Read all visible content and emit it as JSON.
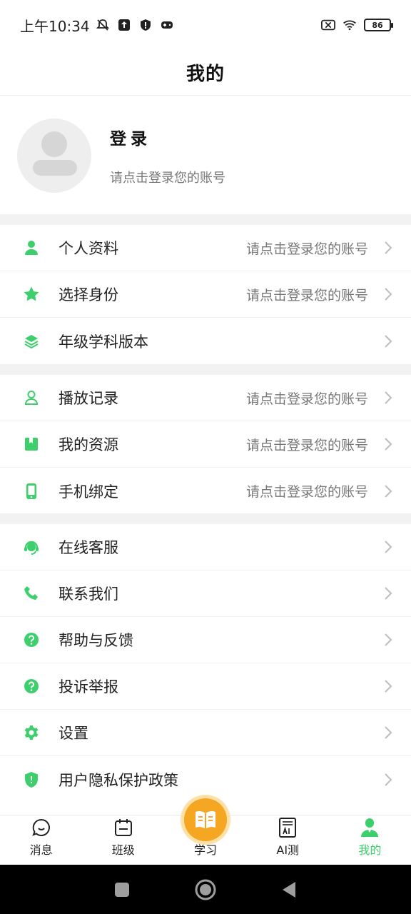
{
  "status_bar": {
    "time": "上午10:34",
    "battery": "86"
  },
  "header": {
    "title": "我的"
  },
  "profile": {
    "login_title": "登录",
    "login_subtitle": "请点击登录您的账号"
  },
  "groups": [
    {
      "items": [
        {
          "icon": "person-icon",
          "label": "个人资料",
          "value": "请点击登录您的账号"
        },
        {
          "icon": "star-icon",
          "label": "选择身份",
          "value": "请点击登录您的账号"
        },
        {
          "icon": "layers-icon",
          "label": "年级学科版本",
          "value": ""
        }
      ]
    },
    {
      "items": [
        {
          "icon": "person-outline-icon",
          "label": "播放记录",
          "value": "请点击登录您的账号"
        },
        {
          "icon": "book-icon",
          "label": "我的资源",
          "value": "请点击登录您的账号"
        },
        {
          "icon": "phone-icon",
          "label": "手机绑定",
          "value": "请点击登录您的账号"
        }
      ]
    },
    {
      "items": [
        {
          "icon": "headset-icon",
          "label": "在线客服",
          "value": ""
        },
        {
          "icon": "call-icon",
          "label": "联系我们",
          "value": ""
        },
        {
          "icon": "help-icon",
          "label": "帮助与反馈",
          "value": ""
        },
        {
          "icon": "help-icon",
          "label": "投诉举报",
          "value": ""
        },
        {
          "icon": "gear-icon",
          "label": "设置",
          "value": ""
        },
        {
          "icon": "shield-icon",
          "label": "用户隐私保护政策",
          "value": ""
        }
      ]
    }
  ],
  "tabs": [
    {
      "icon": "chat-bubble-icon",
      "label": "消息"
    },
    {
      "icon": "calendar-icon",
      "label": "班级"
    },
    {
      "icon": "open-book-icon",
      "label": "学习"
    },
    {
      "icon": "ai-document-icon",
      "label": "AI测"
    },
    {
      "icon": "user-icon",
      "label": "我的",
      "active": true
    }
  ],
  "colors": {
    "accent": "#3ccf6c",
    "study": "#f5a623",
    "divider": "#f2f2f2"
  }
}
